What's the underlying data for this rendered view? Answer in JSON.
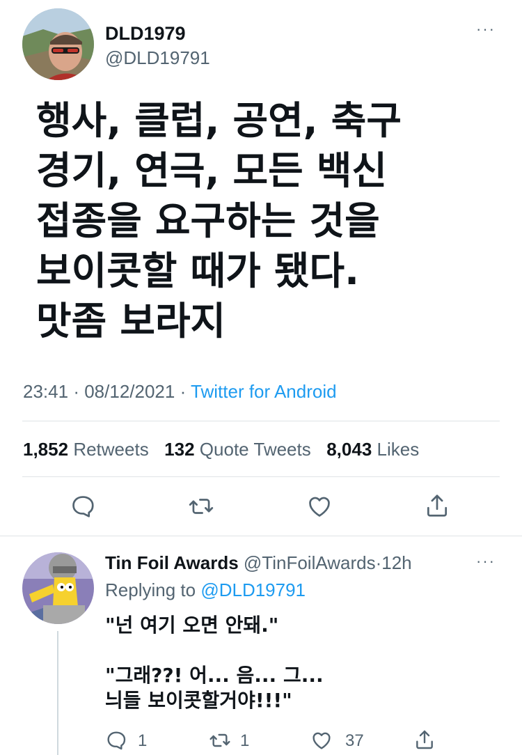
{
  "main_tweet": {
    "author": {
      "name": "DLD1979",
      "handle": "@DLD19791"
    },
    "text_lines": [
      "행사, 클럽, 공연, 축구",
      "경기, 연극, 모든 백신",
      "접종을 요구하는 것을",
      "보이콧할 때가 됐다.",
      "맛좀 보라지"
    ],
    "time": "23:41",
    "date": "08/12/2021",
    "separator": "·",
    "source": "Twitter for Android",
    "stats": {
      "retweets": {
        "count": "1,852",
        "label": "Retweets"
      },
      "quotes": {
        "count": "132",
        "label": "Quote Tweets"
      },
      "likes": {
        "count": "8,043",
        "label": "Likes"
      }
    },
    "actions": [
      "reply-icon",
      "retweet-icon",
      "like-icon",
      "share-icon"
    ]
  },
  "reply": {
    "author": {
      "name": "Tin Foil Awards",
      "handle": "@TinFoilAwards",
      "time": "12h"
    },
    "replying_to_label": "Replying to",
    "replying_to_handle": "@DLD19791",
    "lines": [
      "\"넌 여기 오면 안돼.\"",
      "\"그래??! 어... 음... 그...",
      "늬들 보이콧할거야!!!\""
    ],
    "counts": {
      "reply": "1",
      "retweet": "1",
      "like": "37"
    }
  },
  "colors": {
    "accent": "#1d9bf0",
    "text": "#0f1419",
    "muted": "#536471",
    "divider": "#dfe3e6"
  }
}
